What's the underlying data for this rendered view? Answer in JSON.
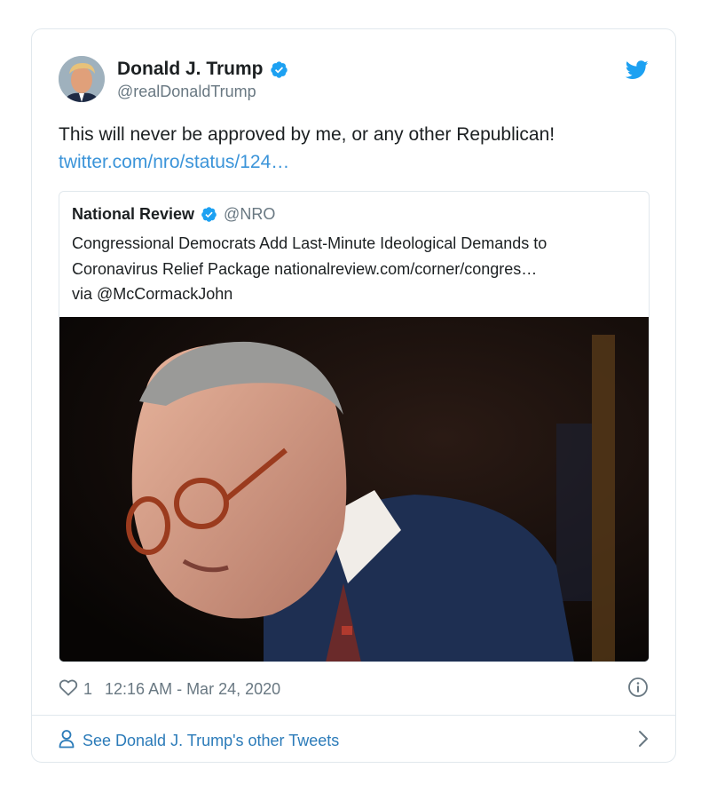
{
  "tweet": {
    "author_name": "Donald J. Trump",
    "author_handle": "@realDonaldTrump",
    "text": "This will never be approved by me, or any other Republican!",
    "link": "twitter.com/nro/status/124…",
    "like_count": "1",
    "timestamp": "12:16 AM - Mar 24, 2020"
  },
  "quoted": {
    "name": "National Review",
    "handle": "@NRO",
    "lines": [
      "Congressional Democrats Add Last-Minute Ideological Demands to",
      "Coronavirus Relief Package nationalreview.com/corner/congres…",
      "via @McCormackJohn"
    ]
  },
  "footer": {
    "see_more": "See Donald J. Trump's other Tweets"
  },
  "icons": {
    "bird": "twitter-bird-icon",
    "verified": "verified-badge-icon",
    "like": "heart-icon",
    "info": "info-icon",
    "profile": "person-icon",
    "chevron": "chevron-right-icon"
  },
  "colors": {
    "brand_blue": "#1da1f2",
    "link_blue": "#3b94d9",
    "secondary_text": "#697882",
    "border": "#e1e8ed"
  }
}
